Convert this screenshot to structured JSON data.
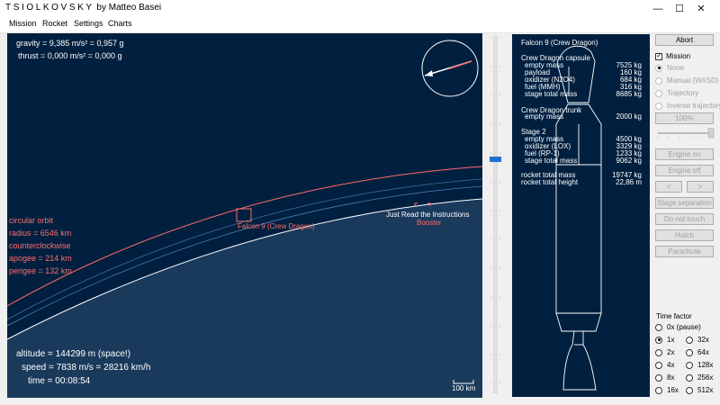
{
  "window": {
    "brand": "TSIOLKOVSKY",
    "byline": "by Matteo Basei",
    "controls": {
      "minimize": "—",
      "maximize": "☐",
      "close": "✕"
    }
  },
  "menu": [
    "Mission",
    "Rocket",
    "Settings",
    "Charts"
  ],
  "hud": {
    "gravity": "gravity = 9,385 m/s² = 0,957 g",
    "thrust": "thrust = 0,000 m/s² = 0,000 g",
    "altitude": "altitude = 144299 m (space!)",
    "speed": "speed = 7838 m/s = 28216 km/h",
    "time": "time = 00:08:54",
    "scale": "100 km"
  },
  "orbit": {
    "type": "circular orbit",
    "radius": "radius = 6546 km",
    "direction": "counterclockwise",
    "apogee": "apogee = 214 km",
    "perigee": "perigee = 132 km"
  },
  "labels": {
    "rocket": "Falcon 9 (Crew Dragon)",
    "ship": "Just Read the Instructions",
    "booster": "Booster"
  },
  "colors": {
    "space": "#01203f",
    "orbit": "#ff6c6c",
    "text": "#ffffff",
    "slider_thumb": "#1e73d2"
  },
  "panel": {
    "title": "Falcon 9 (Crew Dragon)",
    "capsule": {
      "name": "Crew Dragon capsule",
      "rows": [
        {
          "label": "empty mass",
          "value": "7525 kg"
        },
        {
          "label": "payload",
          "value": "160 kg"
        },
        {
          "label": "oxidizer (N2O4)",
          "value": "684 kg"
        },
        {
          "label": "fuel (MMH)",
          "value": "316 kg"
        },
        {
          "label": "stage total mass",
          "value": "8685 kg"
        }
      ]
    },
    "trunk": {
      "name": "Crew Dragon trunk",
      "rows": [
        {
          "label": "empty mass",
          "value": "2000 kg"
        }
      ]
    },
    "stage2": {
      "name": "Stage 2",
      "rows": [
        {
          "label": "empty mass",
          "value": "4500 kg"
        },
        {
          "label": "oxidizer (LOX)",
          "value": "3329 kg"
        },
        {
          "label": "fuel (RP-1)",
          "value": "1233 kg"
        },
        {
          "label": "stage total mass",
          "value": "9062 kg"
        }
      ]
    },
    "totals": [
      {
        "label": "rocket total mass",
        "value": "19747 kg"
      },
      {
        "label": "rocket total height",
        "value": "22,86 m"
      }
    ]
  },
  "controls": {
    "abort": "Abort",
    "mission_check": "Mission",
    "modes": [
      "None",
      "Manual (WASD)",
      "Trajectory",
      "Inverse trajectory"
    ],
    "throttle": "100%",
    "engine_on": "Engine on",
    "engine_off": "Engine off",
    "left": "<",
    "right": ">",
    "stage_sep": "Stage separation",
    "do_not_touch": "Do not touch",
    "hatch": "Hatch",
    "parachute": "Parachute",
    "time_factor_label": "Time factor",
    "time_factors": [
      "0x (pause)",
      "1x",
      "2x",
      "4x",
      "8x",
      "16x",
      "32x",
      "64x",
      "128x",
      "256x",
      "512x"
    ],
    "time_factor_selected": "1x"
  }
}
